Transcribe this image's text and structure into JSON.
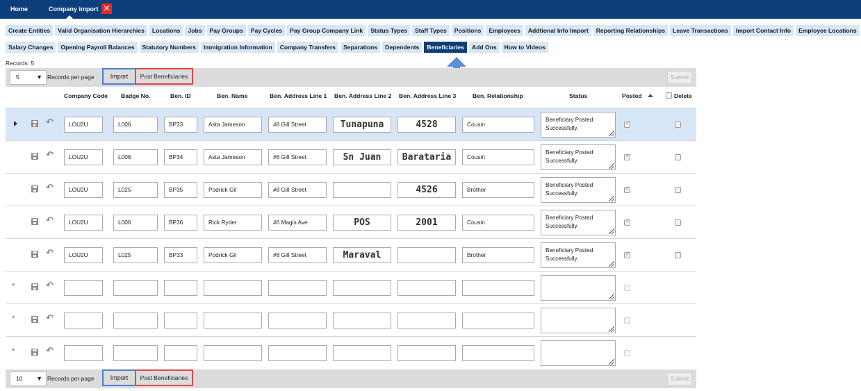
{
  "topbar": {
    "home_label": "Home",
    "company_import_label": "Company import",
    "close_glyph": "✕"
  },
  "tabs_row1": [
    "Create Entities",
    "Valid Organisation Hierarchies",
    "Locations",
    "Jobs",
    "Pay Groups",
    "Pay Cycles",
    "Pay Group Company Link",
    "Status Types",
    "Staff Types",
    "Positions",
    "Employees",
    "Addtional Info Import",
    "Reporting Relationships",
    "Leave Transactions",
    "Import Contact Info",
    "Employee Locations"
  ],
  "tabs_row2": [
    "Salary Changes",
    "Opening Payroll Balances",
    "Statutory Numbers",
    "Immigration Information",
    "Company Transfers",
    "Separations",
    "Dependents",
    "Beneficiaries",
    "Add Ons",
    "How to Videos"
  ],
  "active_tab": "Beneficiaries",
  "records_label": "Records: 5",
  "pager_top": {
    "per_page": "5",
    "per_page_label": "Records per page",
    "import_label": "Import",
    "post_label": "Post Beneficiaries",
    "submit_label": "Submit"
  },
  "pager_bottom": {
    "per_page": "10",
    "per_page_label": "Records per page",
    "import_label": "Import",
    "post_label": "Post Beneficiaries",
    "submit_label": "Submit"
  },
  "columns": [
    "Company Code",
    "Badge No.",
    "Ben. ID",
    "Ben. Name",
    "Ben. Address Line 1",
    "Ben. Address Line 2",
    "Ben. Address Line 3",
    "Ben. Relationship",
    "Status",
    "Posted",
    "Delete"
  ],
  "rows": [
    {
      "company_code": "LOU2U",
      "badge_no": "L006",
      "ben_id": "BP33",
      "ben_name": "Asta Jameson",
      "addr1": "#8 Gill Street",
      "addr2": "Tunapuna",
      "addr3": "4528",
      "relationship": "Cousin",
      "status": "Beneficiary Posted Successfully.",
      "posted": true
    },
    {
      "company_code": "LOU2U",
      "badge_no": "L006",
      "ben_id": "BP34",
      "ben_name": "Asta Jameson",
      "addr1": "#8 Gill Street",
      "addr2": "Sn Juan",
      "addr3": "Barataria",
      "relationship": "Cousin",
      "status": "Beneficiary Posted Successfully.",
      "posted": true
    },
    {
      "company_code": "LOU2U",
      "badge_no": "L025",
      "ben_id": "BP35",
      "ben_name": "Podrick Gil",
      "addr1": "#8 Gill Street",
      "addr2": "",
      "addr3": "4526",
      "relationship": "Brother",
      "status": "Beneficiary Posted Successfully.",
      "posted": true
    },
    {
      "company_code": "LOU2U",
      "badge_no": "L006",
      "ben_id": "BP36",
      "ben_name": "Rick Ryder",
      "addr1": "#6 Magis Ave",
      "addr2": "POS",
      "addr3": "2001",
      "relationship": "Cousin",
      "status": "Beneficiary Posted Successfully.",
      "posted": true
    },
    {
      "company_code": "LOU2U",
      "badge_no": "L025",
      "ben_id": "BP33",
      "ben_name": "Podrick Gil",
      "addr1": "#8 Gill Street",
      "addr2": "Maraval",
      "addr3": "",
      "relationship": "Brother",
      "status": "Beneficiary Posted Successfully.",
      "posted": true
    }
  ],
  "new_row_marker": "*",
  "icons": {
    "save": "save-icon",
    "undo": "undo-icon",
    "expand": "expand-row-icon",
    "sort": "sort-ascending-icon"
  },
  "colors": {
    "topbar": "#0b3e7a",
    "tab_bg": "#d6e7f7",
    "selected_row": "#d7e6f7",
    "import_outline": "#4a7fd0",
    "post_outline": "#e04848"
  }
}
